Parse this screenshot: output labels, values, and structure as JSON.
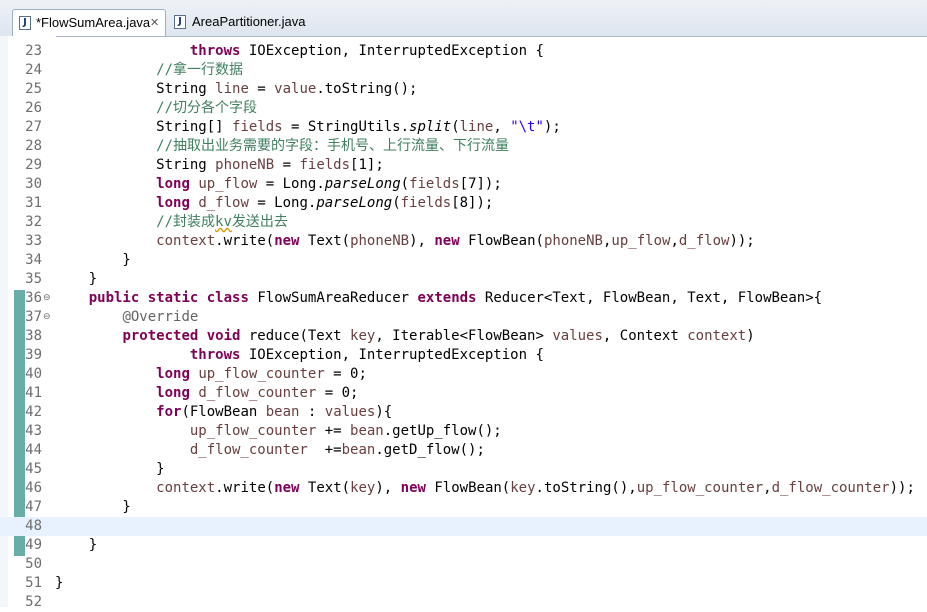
{
  "tabs": [
    {
      "label": "*FlowSumArea.java",
      "active": true,
      "icon": "java-file-icon"
    },
    {
      "label": "AreaPartitioner.java",
      "active": false,
      "icon": "java-file-icon"
    }
  ],
  "current_line": 48,
  "colors": {
    "keyword": "#7f0055",
    "comment": "#3f7f5f",
    "string": "#2a00ff",
    "local_var": "#6a3e3e",
    "annotation": "#646464",
    "current_line_bg": "#e8f2fe"
  },
  "lines": [
    {
      "n": "23",
      "t": [
        [
          "                "
        ],
        [
          "throws",
          "kw"
        ],
        [
          " IOException, InterruptedException {"
        ]
      ]
    },
    {
      "n": "24",
      "t": [
        [
          "            "
        ],
        [
          "//拿一行数据",
          "cm"
        ]
      ]
    },
    {
      "n": "25",
      "t": [
        [
          "            String "
        ],
        [
          "line",
          "var"
        ],
        [
          " = "
        ],
        [
          "value",
          "var"
        ],
        [
          ".toString();"
        ]
      ]
    },
    {
      "n": "26",
      "t": [
        [
          "            "
        ],
        [
          "//切分各个字段",
          "cm"
        ]
      ]
    },
    {
      "n": "27",
      "t": [
        [
          "            String[] "
        ],
        [
          "fields",
          "var"
        ],
        [
          " = StringUtils."
        ],
        [
          "split",
          "it"
        ],
        [
          "("
        ],
        [
          "line",
          "var"
        ],
        [
          ", "
        ],
        [
          "\"\\t\"",
          "str"
        ],
        [
          ");"
        ]
      ]
    },
    {
      "n": "28",
      "t": [
        [
          "            "
        ],
        [
          "//抽取出业务需要的字段：手机号、上行流量、下行流量",
          "cm"
        ]
      ]
    },
    {
      "n": "29",
      "t": [
        [
          "            String "
        ],
        [
          "phoneNB",
          "var"
        ],
        [
          " = "
        ],
        [
          "fields",
          "var"
        ],
        [
          "[1];"
        ]
      ]
    },
    {
      "n": "30",
      "t": [
        [
          "            "
        ],
        [
          "long",
          "kw"
        ],
        [
          " "
        ],
        [
          "up_flow",
          "var"
        ],
        [
          " = Long."
        ],
        [
          "parseLong",
          "it"
        ],
        [
          "("
        ],
        [
          "fields",
          "var"
        ],
        [
          "[7]);"
        ]
      ]
    },
    {
      "n": "31",
      "t": [
        [
          "            "
        ],
        [
          "long",
          "kw"
        ],
        [
          " "
        ],
        [
          "d_flow",
          "var"
        ],
        [
          " = Long."
        ],
        [
          "parseLong",
          "it"
        ],
        [
          "("
        ],
        [
          "fields",
          "var"
        ],
        [
          "[8]);"
        ]
      ]
    },
    {
      "n": "32",
      "t": [
        [
          "            "
        ],
        [
          "//封装成",
          "cm"
        ],
        [
          "kv",
          "cm spell"
        ],
        [
          "发送出去",
          "cm"
        ]
      ]
    },
    {
      "n": "33",
      "t": [
        [
          "            "
        ],
        [
          "context",
          "var"
        ],
        [
          ".write("
        ],
        [
          "new",
          "kw"
        ],
        [
          " Text("
        ],
        [
          "phoneNB",
          "var"
        ],
        [
          "), "
        ],
        [
          "new",
          "kw"
        ],
        [
          " FlowBean("
        ],
        [
          "phoneNB",
          "var"
        ],
        [
          ","
        ],
        [
          "up_flow",
          "var"
        ],
        [
          ","
        ],
        [
          "d_flow",
          "var"
        ],
        [
          "));"
        ]
      ]
    },
    {
      "n": "34",
      "t": [
        [
          "        }"
        ]
      ]
    },
    {
      "n": "35",
      "t": [
        [
          "    }"
        ]
      ]
    },
    {
      "n": "36",
      "t": [
        [
          "    "
        ],
        [
          "public",
          "kw"
        ],
        [
          " "
        ],
        [
          "static",
          "kw"
        ],
        [
          " "
        ],
        [
          "class",
          "kw"
        ],
        [
          " FlowSumAreaReducer "
        ],
        [
          "extends",
          "kw"
        ],
        [
          " Reducer<Text, FlowBean, Text, FlowBean>{"
        ]
      ],
      "fold": true
    },
    {
      "n": "37",
      "t": [
        [
          "        "
        ],
        [
          "@Override",
          "an"
        ]
      ],
      "fold": true
    },
    {
      "n": "38",
      "t": [
        [
          "        "
        ],
        [
          "protected",
          "kw"
        ],
        [
          " "
        ],
        [
          "void",
          "kw"
        ],
        [
          " reduce(Text "
        ],
        [
          "key",
          "var"
        ],
        [
          ", Iterable<FlowBean> "
        ],
        [
          "values",
          "var"
        ],
        [
          ", Context "
        ],
        [
          "context",
          "var"
        ],
        [
          ")"
        ]
      ]
    },
    {
      "n": "39",
      "t": [
        [
          "                "
        ],
        [
          "throws",
          "kw"
        ],
        [
          " IOException, InterruptedException {"
        ]
      ]
    },
    {
      "n": "40",
      "t": [
        [
          "            "
        ],
        [
          "long",
          "kw"
        ],
        [
          " "
        ],
        [
          "up_flow_counter",
          "var"
        ],
        [
          " = 0;"
        ]
      ]
    },
    {
      "n": "41",
      "t": [
        [
          "            "
        ],
        [
          "long",
          "kw"
        ],
        [
          " "
        ],
        [
          "d_flow_counter",
          "var"
        ],
        [
          " = 0;"
        ]
      ]
    },
    {
      "n": "42",
      "t": [
        [
          "            "
        ],
        [
          "for",
          "kw"
        ],
        [
          "(FlowBean "
        ],
        [
          "bean",
          "var"
        ],
        [
          " : "
        ],
        [
          "values",
          "var"
        ],
        [
          "){"
        ]
      ]
    },
    {
      "n": "43",
      "t": [
        [
          "                "
        ],
        [
          "up_flow_counter",
          "var"
        ],
        [
          " += "
        ],
        [
          "bean",
          "var"
        ],
        [
          ".getUp_flow();"
        ]
      ]
    },
    {
      "n": "44",
      "t": [
        [
          "                "
        ],
        [
          "d_flow_counter",
          "var"
        ],
        [
          "  +="
        ],
        [
          "bean",
          "var"
        ],
        [
          ".getD_flow();"
        ]
      ]
    },
    {
      "n": "45",
      "t": [
        [
          "            }"
        ]
      ]
    },
    {
      "n": "46",
      "t": [
        [
          "            "
        ],
        [
          "context",
          "var"
        ],
        [
          ".write("
        ],
        [
          "new",
          "kw"
        ],
        [
          " Text("
        ],
        [
          "key",
          "var"
        ],
        [
          "), "
        ],
        [
          "new",
          "kw"
        ],
        [
          " FlowBean("
        ],
        [
          "key",
          "var"
        ],
        [
          ".toString(),"
        ],
        [
          "up_flow_counter",
          "var"
        ],
        [
          ","
        ],
        [
          "d_flow_counter",
          "var"
        ],
        [
          "));"
        ]
      ]
    },
    {
      "n": "47",
      "t": [
        [
          "        }"
        ]
      ]
    },
    {
      "n": "48",
      "t": [
        [
          ""
        ]
      ]
    },
    {
      "n": "49",
      "t": [
        [
          "    }"
        ]
      ]
    },
    {
      "n": "50",
      "t": [
        [
          ""
        ]
      ]
    },
    {
      "n": "51",
      "t": [
        [
          "}"
        ]
      ]
    },
    {
      "n": "52",
      "t": [
        [
          ""
        ]
      ]
    }
  ]
}
